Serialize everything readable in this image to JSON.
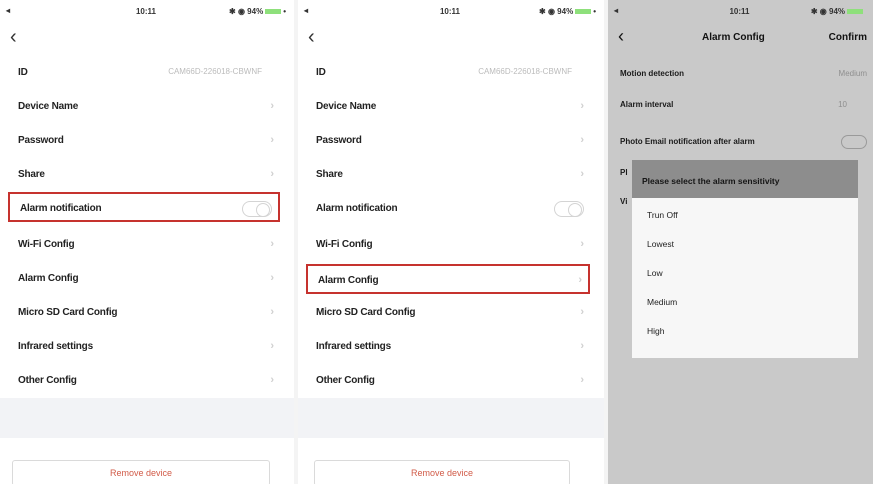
{
  "screen1": {
    "status": {
      "time": "10:11",
      "right": "✱ ◉ 94%"
    },
    "rows": [
      {
        "label": "ID",
        "value": "CAM66D-226018-CBWNF"
      },
      {
        "label": "Device Name"
      },
      {
        "label": "Password"
      },
      {
        "label": "Share"
      },
      {
        "label": "Alarm notification"
      },
      {
        "label": "Wi-Fi Config"
      },
      {
        "label": "Alarm Config"
      },
      {
        "label": "Micro SD Card Config"
      },
      {
        "label": "Infrared settings"
      },
      {
        "label": "Other Config"
      }
    ],
    "remove_label": "Remove device"
  },
  "screen2": {
    "status": {
      "time": "10:11",
      "right": "✱ ◉ 94%"
    },
    "rows": [
      {
        "label": "ID",
        "value": "CAM66D-226018-CBWNF"
      },
      {
        "label": "Device Name"
      },
      {
        "label": "Password"
      },
      {
        "label": "Share"
      },
      {
        "label": "Alarm notification"
      },
      {
        "label": "Wi-Fi Config"
      },
      {
        "label": "Alarm Config"
      },
      {
        "label": "Micro SD Card Config"
      },
      {
        "label": "Infrared settings"
      },
      {
        "label": "Other Config"
      }
    ],
    "remove_label": "Remove device"
  },
  "screen3": {
    "status": {
      "time": "10:11",
      "right": "✱ ◉ 94%"
    },
    "title": "Alarm Config",
    "confirm_label": "Confirm",
    "rows": [
      {
        "label": "Motion detection",
        "value": "Medium"
      },
      {
        "label": "Alarm interval",
        "value": "10"
      },
      {
        "label": "Photo Email notification after alarm"
      }
    ],
    "partial_labels": [
      "Pl",
      "Vi"
    ],
    "sheet": {
      "title": "Please select the alarm sensitivity",
      "options": [
        "Trun Off",
        "Lowest",
        "Low",
        "Medium",
        "High"
      ]
    }
  },
  "colors": {
    "highlight": "#c6322e",
    "remove_text": "#d15b48",
    "sheet_header": "#8d8d8d"
  },
  "icons": {
    "back": "chevron-left-icon",
    "row_arrow": "chevron-right-icon"
  }
}
